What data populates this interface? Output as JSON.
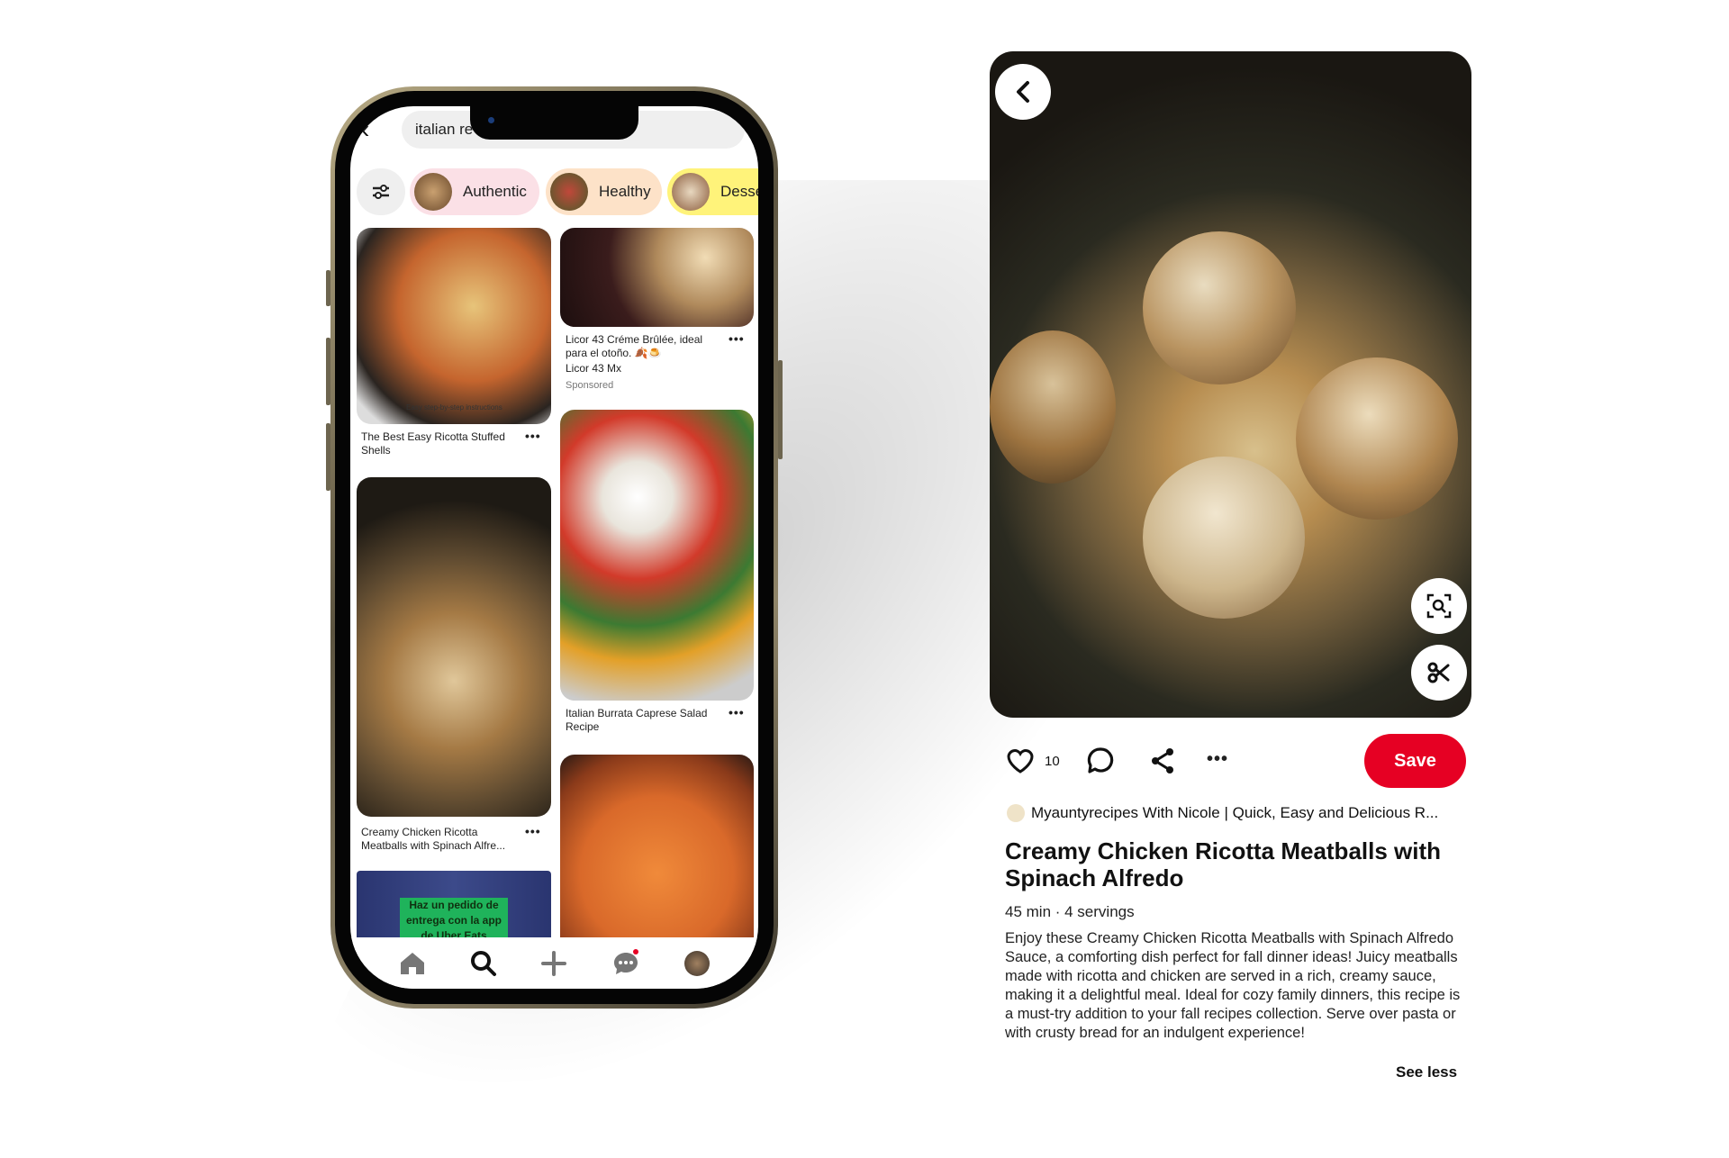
{
  "phone": {
    "search": {
      "value": "italian re"
    },
    "chips": [
      {
        "label": "Authentic",
        "bg": "#fbe0e6"
      },
      {
        "label": "Healthy",
        "bg": "#fde2c8"
      },
      {
        "label": "Desse",
        "bg": "#fff37a"
      }
    ],
    "pins_left": [
      {
        "title": "The Best Easy Ricotta Stuffed Shells",
        "overlay": "Easy step-by-step instructions"
      },
      {
        "title": "Creamy Chicken Ricotta Meatballs with Spinach Alfre..."
      },
      {
        "ad_text": "Haz un pedido de entrega con la app de Uber Eats"
      }
    ],
    "pins_right": [
      {
        "title": "Licor 43 Créme Brûlée, ideal para el otoño. 🍂🍮",
        "source": "Licor 43 Mx",
        "badge": "Sponsored"
      },
      {
        "title": "Italian Burrata Caprese Salad Recipe"
      },
      {
        "title": ""
      }
    ],
    "nav": [
      "home-icon",
      "search-icon",
      "plus-icon",
      "chat-icon",
      "profile-avatar"
    ]
  },
  "detail": {
    "likes": "10",
    "save_label": "Save",
    "author": "Myauntyrecipes With Nicole | Quick, Easy and Delicious R...",
    "title": "Creamy Chicken Ricotta Meatballs with Spinach Alfredo",
    "meta": "45 min · 4 servings",
    "description": "Enjoy these Creamy Chicken Ricotta Meatballs with Spinach Alfredo Sauce, a comforting dish perfect for fall dinner ideas! Juicy meatballs made with ricotta and chicken are served in a rich, creamy sauce, making it a delightful meal. Ideal for cozy family dinners, this recipe is a must-try addition to your fall recipes collection. Serve over pasta or with crusty bread for an indulgent experience!",
    "see_less": "See less"
  },
  "colors": {
    "accent": "#e60023"
  }
}
